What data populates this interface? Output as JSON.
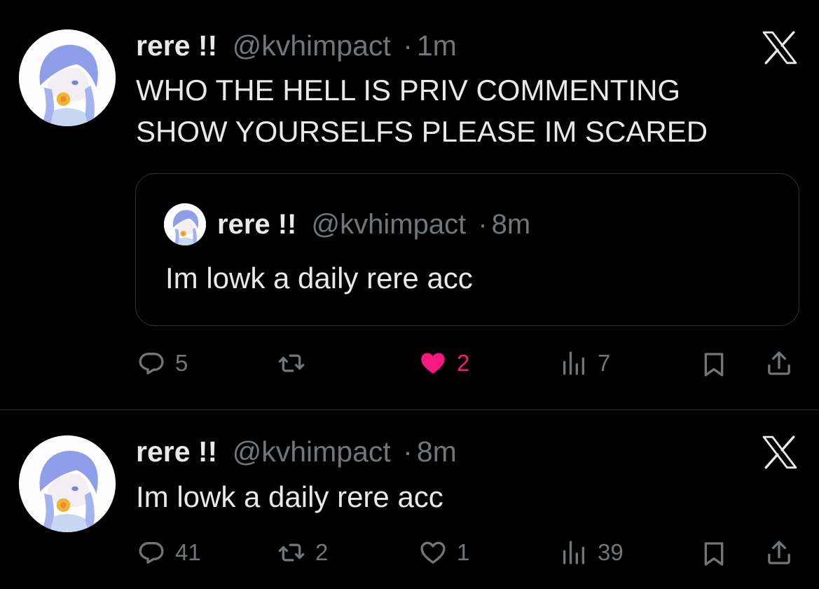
{
  "colors": {
    "background": "#000000",
    "text_primary": "#e7e9ea",
    "text_secondary": "#71767b",
    "like_active": "#f91880",
    "border": "#2f3336"
  },
  "tweets": [
    {
      "author_name": "rere !!",
      "handle": "@kvhimpact",
      "separator": "·",
      "time": "1m",
      "text": "WHO THE HELL IS PRIV COMMENTING\nSHOW YOURSELFS PLEASE IM SCARED",
      "quoted": {
        "author_name": "rere !!",
        "handle": "@kvhimpact",
        "separator": "·",
        "time": "8m",
        "text": "Im lowk a daily rere acc"
      },
      "actions": {
        "replies": "5",
        "reposts": "",
        "likes": "2",
        "liked": true,
        "views": "7"
      }
    },
    {
      "author_name": "rere !!",
      "handle": "@kvhimpact",
      "separator": "·",
      "time": "8m",
      "text": "Im lowk a daily rere acc",
      "actions": {
        "replies": "41",
        "reposts": "2",
        "likes": "1",
        "liked": false,
        "views": "39"
      }
    }
  ],
  "icons": {
    "close": "x-logo-icon",
    "reply": "reply-icon",
    "repost": "repost-icon",
    "like": "heart-icon",
    "views": "views-icon",
    "bookmark": "bookmark-icon",
    "share": "share-icon"
  }
}
